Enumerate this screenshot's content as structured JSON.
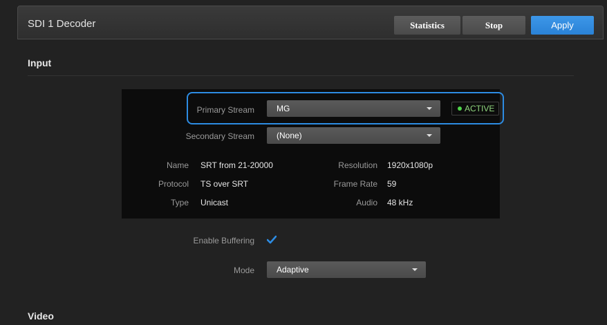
{
  "header": {
    "title": "SDI 1 Decoder",
    "buttons": {
      "statistics": "Statistics",
      "stop": "Stop",
      "apply": "Apply"
    }
  },
  "input": {
    "title": "Input",
    "primary_stream": {
      "label": "Primary Stream",
      "value": "MG",
      "status": "ACTIVE"
    },
    "secondary_stream": {
      "label": "Secondary Stream",
      "value": "(None)"
    },
    "details": {
      "name": {
        "label": "Name",
        "value": "SRT from 21-20000"
      },
      "protocol": {
        "label": "Protocol",
        "value": "TS over SRT"
      },
      "type": {
        "label": "Type",
        "value": "Unicast"
      },
      "resolution": {
        "label": "Resolution",
        "value": "1920x1080p"
      },
      "frame_rate": {
        "label": "Frame Rate",
        "value": "59"
      },
      "audio": {
        "label": "Audio",
        "value": "48 kHz"
      }
    },
    "enable_buffering": {
      "label": "Enable Buffering",
      "checked": true
    },
    "mode": {
      "label": "Mode",
      "value": "Adaptive"
    }
  },
  "video": {
    "title": "Video"
  },
  "colors": {
    "accent": "#2d8ce3",
    "active": "#4fd54a"
  }
}
